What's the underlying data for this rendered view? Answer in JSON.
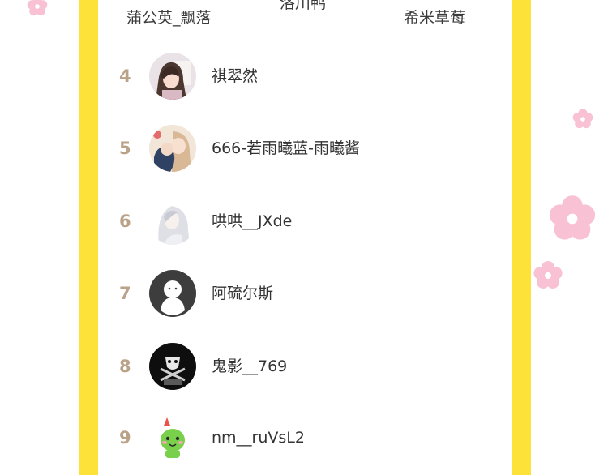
{
  "colors": {
    "side_bar": "#fde23a",
    "rank_number": "#b9a287",
    "name_text": "#333333",
    "flower": "#f9c2d4"
  },
  "podium": {
    "second_name": "蒲公英_飘落",
    "first_name": "洛川鸭",
    "third_name": "希米草莓"
  },
  "ranking": [
    {
      "rank": "4",
      "name": "祺翠然",
      "avatar": "anime-girl-avatar"
    },
    {
      "rank": "5",
      "name": "666-若雨曦蓝-雨曦酱",
      "avatar": "anime-couple-avatar"
    },
    {
      "rank": "6",
      "name": "哄哄__JXde",
      "avatar": "white-hair-girl-avatar"
    },
    {
      "rank": "7",
      "name": "阿硫尔斯",
      "avatar": "default-person-avatar"
    },
    {
      "rank": "8",
      "name": "鬼影__769",
      "avatar": "mask-avatar"
    },
    {
      "rank": "9",
      "name": "nm__ruVsL2",
      "avatar": "green-cartoon-avatar"
    }
  ]
}
